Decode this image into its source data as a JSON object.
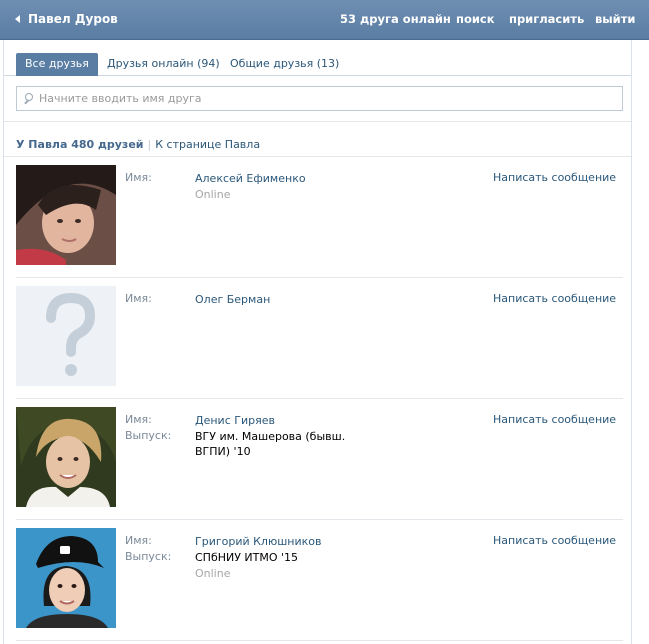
{
  "header": {
    "back_label": "Павел Дуров",
    "online_count": "53 друга онлайн",
    "search": "поиск",
    "invite": "пригласить",
    "logout": "выйти"
  },
  "tabs": [
    {
      "label": "Все друзья",
      "active": true
    },
    {
      "label": "Друзья онлайн (94)",
      "active": false
    },
    {
      "label": "Общие друзья (13)",
      "active": false
    }
  ],
  "search": {
    "placeholder": "Начните вводить имя друга",
    "value": ""
  },
  "summary": {
    "count": "У Павла 480 друзей",
    "separator": "|",
    "link": "К странице Павла"
  },
  "labels": {
    "name": "Имя:",
    "graduation": "Выпуск:"
  },
  "friends": [
    {
      "name": "Алексей Ефименко",
      "status": "Online",
      "message": "Написать сообщение"
    },
    {
      "name": "Олег Берман",
      "message": "Написать сообщение"
    },
    {
      "name": "Денис Гиряев",
      "graduation_line1": "ВГУ им. Машерова (бывш.",
      "graduation_line2": "ВГПИ) '10",
      "message": "Написать сообщение"
    },
    {
      "name": "Григорий Клюшников",
      "graduation": "СПбНИУ ИТМО '15",
      "status": "Online",
      "message": "Написать сообщение"
    }
  ],
  "colors": {
    "header_bg": "#5f82a8",
    "accent": "#2b587a",
    "tab_active": "#597da3"
  }
}
